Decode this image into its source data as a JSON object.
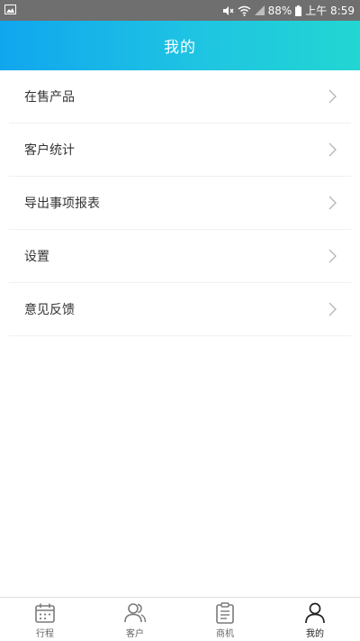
{
  "status_bar": {
    "battery": "88%",
    "time": "上午 8:59"
  },
  "header": {
    "title": "我的"
  },
  "menu": {
    "items": [
      {
        "label": "在售产品"
      },
      {
        "label": "客户统计"
      },
      {
        "label": "导出事项报表"
      },
      {
        "label": "设置"
      },
      {
        "label": "意见反馈"
      }
    ]
  },
  "tabbar": {
    "tabs": [
      {
        "label": "行程",
        "icon": "calendar-icon"
      },
      {
        "label": "客户",
        "icon": "users-icon"
      },
      {
        "label": "商机",
        "icon": "clipboard-icon"
      },
      {
        "label": "我的",
        "icon": "user-icon",
        "active": true
      }
    ]
  },
  "colors": {
    "header_start": "#10a6ee",
    "header_end": "#22d6d2",
    "status_bar": "#6f6f6f"
  }
}
